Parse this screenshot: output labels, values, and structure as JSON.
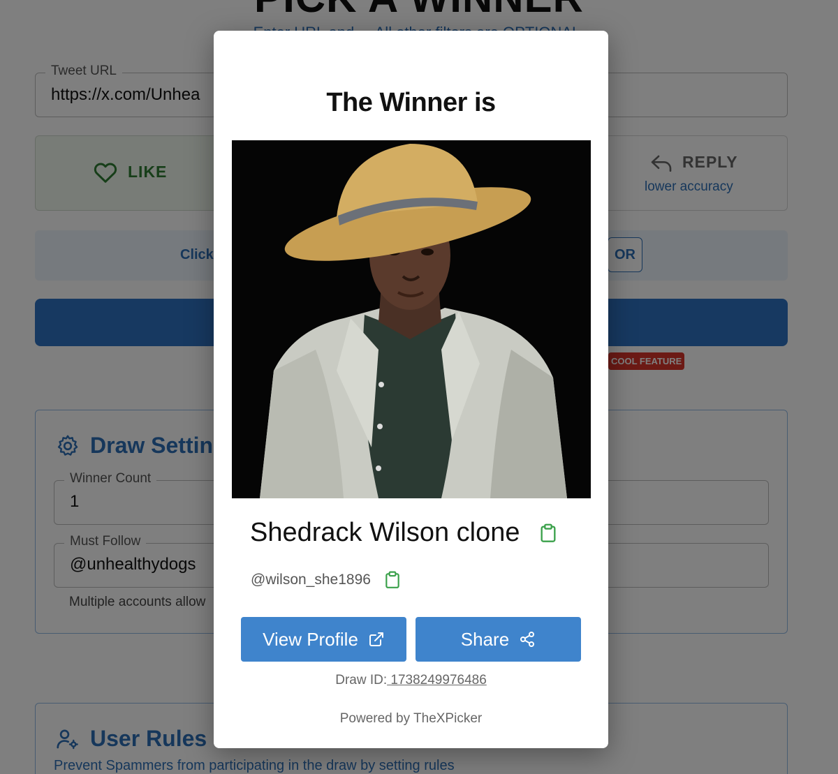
{
  "background": {
    "page_title": "PICK A WINNER",
    "subtitle": "Enter URL and ... All other filters are OPTIONAL.",
    "tweet_url": {
      "label": "Tweet URL",
      "value": "https://x.com/Unhea"
    },
    "like_label": "LIKE",
    "reply": {
      "label": "REPLY",
      "sub": "lower accuracy"
    },
    "info_text": "Click",
    "or_label": "OR",
    "cool_badge": "COOL FEATURE",
    "draw_settings": {
      "title": "Draw Settin",
      "winner_count": {
        "label": "Winner Count",
        "value": "1"
      },
      "must_follow": {
        "label": "Must Follow",
        "value": "@unhealthydogs"
      },
      "helper": "Multiple accounts allow"
    },
    "user_rules": {
      "title": "User Rules",
      "desc": "Prevent Spammers from participating in the draw by setting rules"
    }
  },
  "modal": {
    "title": "The Winner is",
    "winner_name": "Shedrack Wilson clone",
    "winner_handle": "@wilson_she1896",
    "view_profile_label": "View Profile",
    "share_label": "Share",
    "draw_id_label": "Draw ID:",
    "draw_id_value": " 1738249976486",
    "powered_by": "Powered by TheXPicker"
  },
  "colors": {
    "primary": "#3f84cc",
    "accent_blue": "#2c6fb7",
    "like_green": "#2e7d32",
    "copy_icon_green": "#3aa04a",
    "badge_red": "#d9342b"
  },
  "icons": [
    "heart-icon",
    "reply-icon",
    "gear-icon",
    "user-rules-icon",
    "clipboard-icon",
    "external-link-icon",
    "share-icon"
  ]
}
